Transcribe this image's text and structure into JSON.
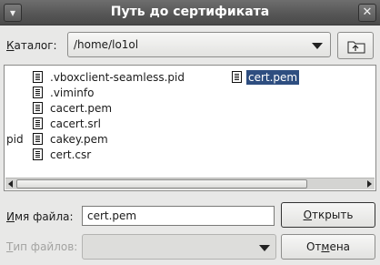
{
  "window": {
    "title": "Путь до сертификата",
    "menu_icon": "▾",
    "close_icon": "✕"
  },
  "catalog": {
    "label_accel": "К",
    "label_rest": "аталог:",
    "current_path": "/home/lo1ol",
    "up_button_icon": "folder-up-icon"
  },
  "files": {
    "col1": [
      ".vboxclient-seamless.pid",
      ".viminfo",
      "cacert.pem",
      "cacert.srl",
      "cakey.pem",
      "cert.csr"
    ],
    "col2": [
      "cert.pem"
    ],
    "selected": "cert.pem",
    "truncated_fragment": "pid"
  },
  "filename": {
    "label_accel": "И",
    "label_rest": "мя файла:",
    "value": "cert.pem"
  },
  "filetype": {
    "label_accel": "Т",
    "label_rest": "ип файлов:",
    "value": ""
  },
  "buttons": {
    "open_accel": "О",
    "open_rest": "ткрыть",
    "cancel_pre": "От",
    "cancel_accel": "м",
    "cancel_post": "ена"
  }
}
